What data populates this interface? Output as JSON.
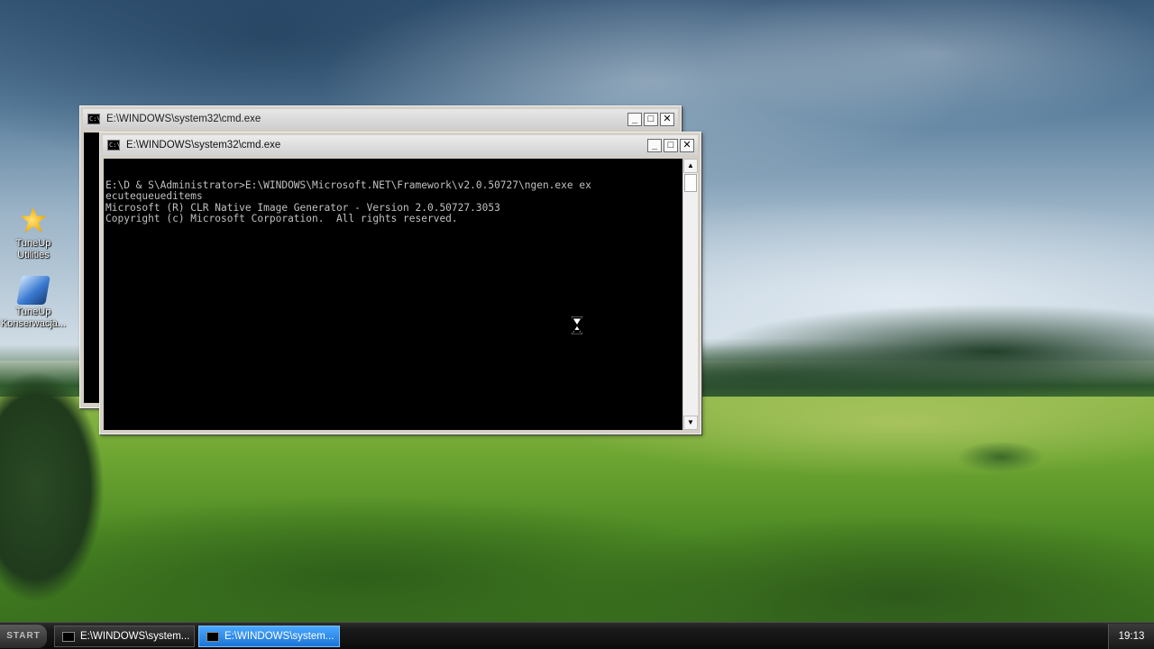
{
  "desktop": {
    "icons": [
      {
        "label": "TuneUp Utilities",
        "icon": "tuneup-star-icon"
      },
      {
        "label": "TuneUp Konserwacja...",
        "icon": "tuneup-maintenance-icon"
      }
    ]
  },
  "windows": {
    "back": {
      "title": "E:\\WINDOWS\\system32\\cmd.exe",
      "icon": "cmd-icon"
    },
    "front": {
      "title": "E:\\WINDOWS\\system32\\cmd.exe",
      "icon": "cmd-icon",
      "console_lines": [
        "E:\\D & S\\Administrator>E:\\WINDOWS\\Microsoft.NET\\Framework\\v2.0.50727\\ngen.exe ex",
        "ecutequeueditems",
        "Microsoft (R) CLR Native Image Generator - Version 2.0.50727.3053",
        "Copyright (c) Microsoft Corporation.  All rights reserved."
      ]
    }
  },
  "taskbar": {
    "start_label": "START",
    "items": [
      {
        "label": "E:\\WINDOWS\\system...",
        "state": "inactive"
      },
      {
        "label": "E:\\WINDOWS\\system...",
        "state": "active"
      }
    ],
    "clock": "19:13"
  },
  "colors": {
    "console_bg": "#000000",
    "console_text": "#c0c0c0",
    "taskbar_active": "#1b74d6"
  }
}
